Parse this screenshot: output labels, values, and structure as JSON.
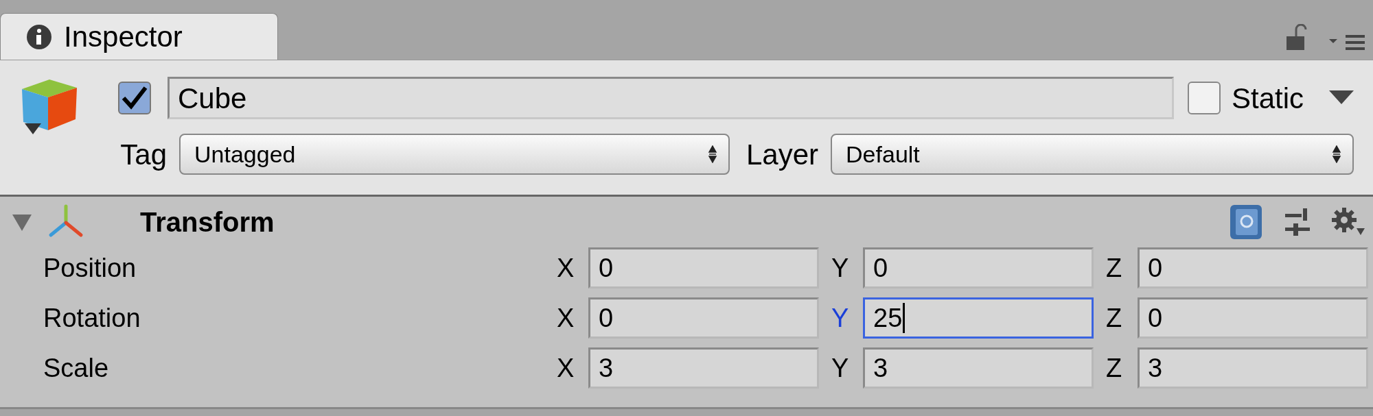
{
  "tab": {
    "label": "Inspector",
    "selected": true
  },
  "object": {
    "active": true,
    "name": "Cube",
    "static": false,
    "static_label": "Static",
    "tag_label": "Tag",
    "tag": "Untagged",
    "layer_label": "Layer",
    "layer": "Default"
  },
  "component": {
    "title": "Transform",
    "expanded": true,
    "rows": [
      {
        "label": "Position",
        "fields": [
          {
            "axis": "X",
            "value": "0",
            "focused": false
          },
          {
            "axis": "Y",
            "value": "0",
            "focused": false
          },
          {
            "axis": "Z",
            "value": "0",
            "focused": false
          }
        ]
      },
      {
        "label": "Rotation",
        "fields": [
          {
            "axis": "X",
            "value": "0",
            "focused": false
          },
          {
            "axis": "Y",
            "value": "25",
            "focused": true
          },
          {
            "axis": "Z",
            "value": "0",
            "focused": false
          }
        ]
      },
      {
        "label": "Scale",
        "fields": [
          {
            "axis": "X",
            "value": "3",
            "focused": false
          },
          {
            "axis": "Y",
            "value": "3",
            "focused": false
          },
          {
            "axis": "Z",
            "value": "3",
            "focused": false
          }
        ]
      }
    ]
  }
}
